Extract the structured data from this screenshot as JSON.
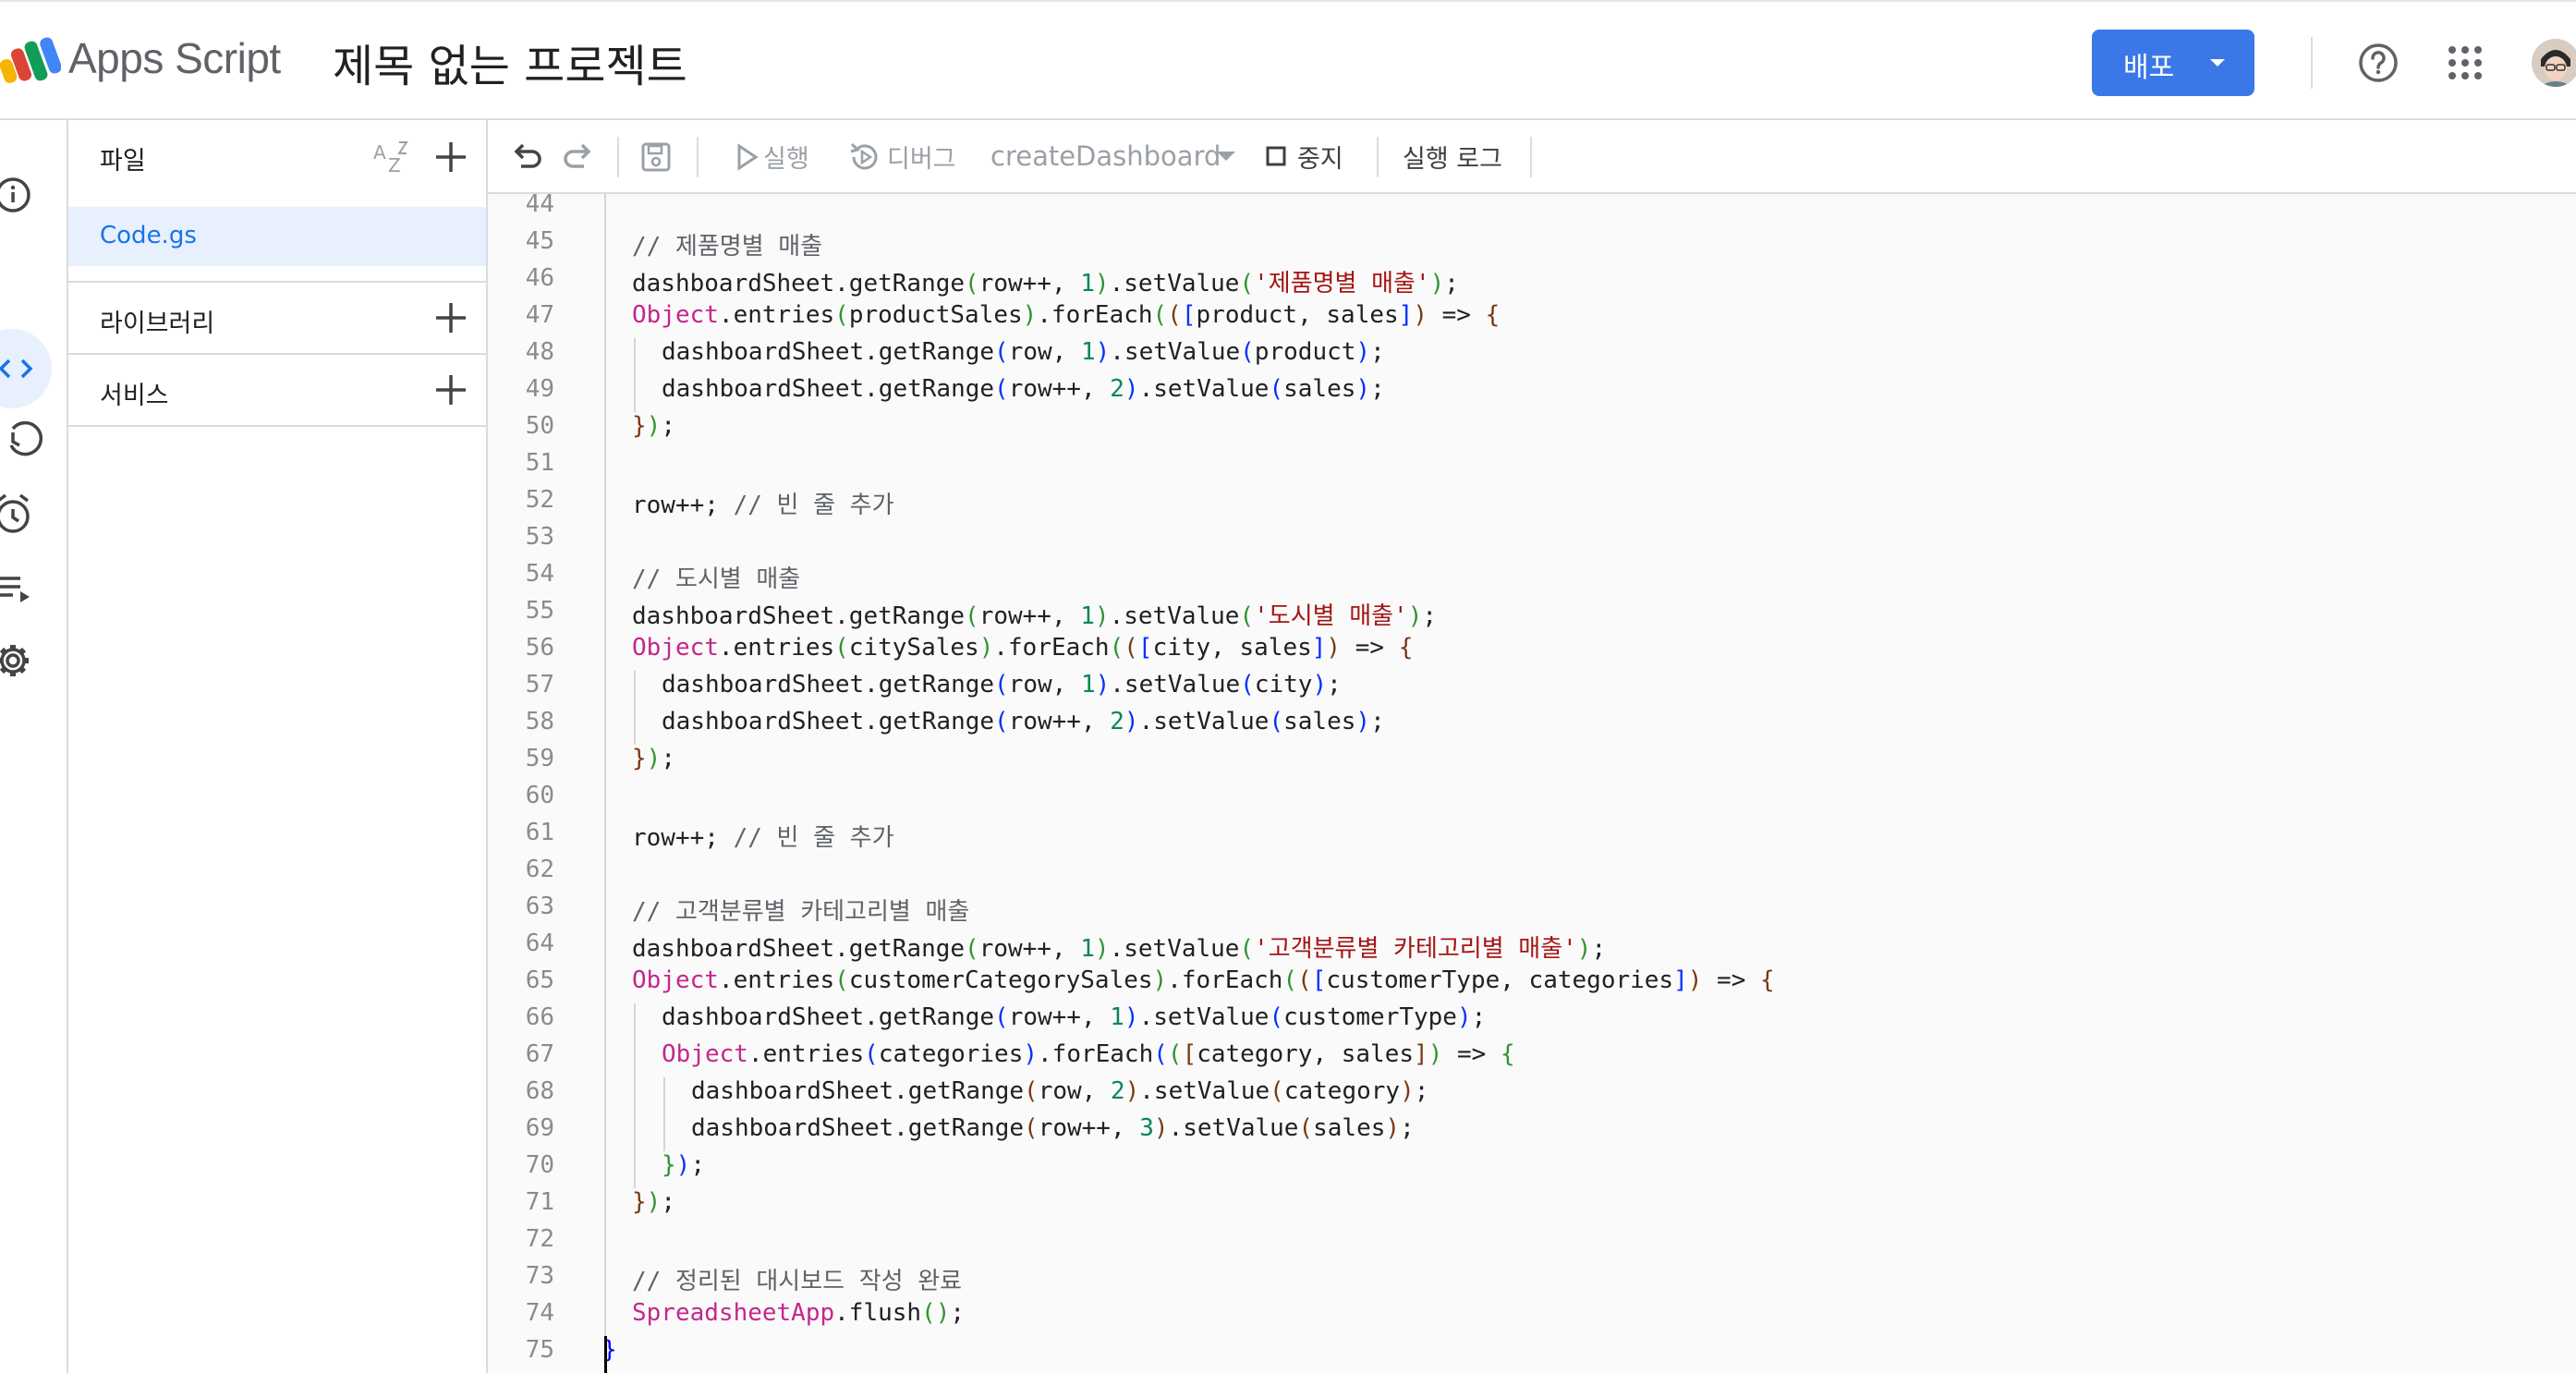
{
  "header": {
    "app_name": "Apps Script",
    "project_title": "제목 없는 프로젝트",
    "deploy_label": "배포"
  },
  "files_panel": {
    "title": "파일",
    "files": [
      "Code.gs"
    ],
    "sections": [
      "라이브러리",
      "서비스"
    ]
  },
  "toolbar": {
    "run_label": "실행",
    "debug_label": "디버그",
    "function_name": "createDashboard",
    "stop_label": "중지",
    "exec_log_label": "실행 로그"
  },
  "colors": {
    "accent": "#3b78e7",
    "keyword": "#c4278c",
    "string": "#a31515",
    "number": "#098658",
    "comment": "#5f6368"
  },
  "editor": {
    "lines": [
      {
        "n": "44",
        "indent": 0,
        "tokens": []
      },
      {
        "n": "45",
        "indent": 0,
        "tokens": [
          {
            "t": "// 제품명별 매출",
            "c": "cmt"
          }
        ]
      },
      {
        "n": "46",
        "indent": 0,
        "tokens": [
          {
            "t": "dashboardSheet.getRange"
          },
          {
            "t": "(",
            "c": "p1"
          },
          {
            "t": "row++, "
          },
          {
            "t": "1",
            "c": "num"
          },
          {
            "t": ")",
            "c": "p1"
          },
          {
            "t": ".setValue"
          },
          {
            "t": "(",
            "c": "p1"
          },
          {
            "t": "'제품명별 매출'",
            "c": "str"
          },
          {
            "t": ")",
            "c": "p1"
          },
          {
            "t": ";"
          }
        ]
      },
      {
        "n": "47",
        "indent": 0,
        "tokens": [
          {
            "t": "Object",
            "c": "kw"
          },
          {
            "t": ".entries"
          },
          {
            "t": "(",
            "c": "p1"
          },
          {
            "t": "productSales"
          },
          {
            "t": ")",
            "c": "p1"
          },
          {
            "t": ".forEach"
          },
          {
            "t": "(",
            "c": "p1"
          },
          {
            "t": "(",
            "c": "p2"
          },
          {
            "t": "[",
            "c": "p3"
          },
          {
            "t": "product, sales"
          },
          {
            "t": "]",
            "c": "p3"
          },
          {
            "t": ")",
            "c": "p2"
          },
          {
            "t": " => "
          },
          {
            "t": "{",
            "c": "p2"
          }
        ]
      },
      {
        "n": "48",
        "indent": 1,
        "tokens": [
          {
            "t": "dashboardSheet.getRange"
          },
          {
            "t": "(",
            "c": "p3"
          },
          {
            "t": "row, "
          },
          {
            "t": "1",
            "c": "num"
          },
          {
            "t": ")",
            "c": "p3"
          },
          {
            "t": ".setValue"
          },
          {
            "t": "(",
            "c": "p3"
          },
          {
            "t": "product"
          },
          {
            "t": ")",
            "c": "p3"
          },
          {
            "t": ";"
          }
        ]
      },
      {
        "n": "49",
        "indent": 1,
        "tokens": [
          {
            "t": "dashboardSheet.getRange"
          },
          {
            "t": "(",
            "c": "p3"
          },
          {
            "t": "row++, "
          },
          {
            "t": "2",
            "c": "num"
          },
          {
            "t": ")",
            "c": "p3"
          },
          {
            "t": ".setValue"
          },
          {
            "t": "(",
            "c": "p3"
          },
          {
            "t": "sales"
          },
          {
            "t": ")",
            "c": "p3"
          },
          {
            "t": ";"
          }
        ]
      },
      {
        "n": "50",
        "indent": 0,
        "tokens": [
          {
            "t": "}",
            "c": "p2"
          },
          {
            "t": ")",
            "c": "p1"
          },
          {
            "t": ";"
          }
        ]
      },
      {
        "n": "51",
        "indent": 0,
        "tokens": []
      },
      {
        "n": "52",
        "indent": 0,
        "tokens": [
          {
            "t": "row++; "
          },
          {
            "t": "// 빈 줄 추가",
            "c": "cmt"
          }
        ]
      },
      {
        "n": "53",
        "indent": 0,
        "tokens": []
      },
      {
        "n": "54",
        "indent": 0,
        "tokens": [
          {
            "t": "// 도시별 매출",
            "c": "cmt"
          }
        ]
      },
      {
        "n": "55",
        "indent": 0,
        "tokens": [
          {
            "t": "dashboardSheet.getRange"
          },
          {
            "t": "(",
            "c": "p1"
          },
          {
            "t": "row++, "
          },
          {
            "t": "1",
            "c": "num"
          },
          {
            "t": ")",
            "c": "p1"
          },
          {
            "t": ".setValue"
          },
          {
            "t": "(",
            "c": "p1"
          },
          {
            "t": "'도시별 매출'",
            "c": "str"
          },
          {
            "t": ")",
            "c": "p1"
          },
          {
            "t": ";"
          }
        ]
      },
      {
        "n": "56",
        "indent": 0,
        "tokens": [
          {
            "t": "Object",
            "c": "kw"
          },
          {
            "t": ".entries"
          },
          {
            "t": "(",
            "c": "p1"
          },
          {
            "t": "citySales"
          },
          {
            "t": ")",
            "c": "p1"
          },
          {
            "t": ".forEach"
          },
          {
            "t": "(",
            "c": "p1"
          },
          {
            "t": "(",
            "c": "p2"
          },
          {
            "t": "[",
            "c": "p3"
          },
          {
            "t": "city, sales"
          },
          {
            "t": "]",
            "c": "p3"
          },
          {
            "t": ")",
            "c": "p2"
          },
          {
            "t": " => "
          },
          {
            "t": "{",
            "c": "p2"
          }
        ]
      },
      {
        "n": "57",
        "indent": 1,
        "tokens": [
          {
            "t": "dashboardSheet.getRange"
          },
          {
            "t": "(",
            "c": "p3"
          },
          {
            "t": "row, "
          },
          {
            "t": "1",
            "c": "num"
          },
          {
            "t": ")",
            "c": "p3"
          },
          {
            "t": ".setValue"
          },
          {
            "t": "(",
            "c": "p3"
          },
          {
            "t": "city"
          },
          {
            "t": ")",
            "c": "p3"
          },
          {
            "t": ";"
          }
        ]
      },
      {
        "n": "58",
        "indent": 1,
        "tokens": [
          {
            "t": "dashboardSheet.getRange"
          },
          {
            "t": "(",
            "c": "p3"
          },
          {
            "t": "row++, "
          },
          {
            "t": "2",
            "c": "num"
          },
          {
            "t": ")",
            "c": "p3"
          },
          {
            "t": ".setValue"
          },
          {
            "t": "(",
            "c": "p3"
          },
          {
            "t": "sales"
          },
          {
            "t": ")",
            "c": "p3"
          },
          {
            "t": ";"
          }
        ]
      },
      {
        "n": "59",
        "indent": 0,
        "tokens": [
          {
            "t": "}",
            "c": "p2"
          },
          {
            "t": ")",
            "c": "p1"
          },
          {
            "t": ";"
          }
        ]
      },
      {
        "n": "60",
        "indent": 0,
        "tokens": []
      },
      {
        "n": "61",
        "indent": 0,
        "tokens": [
          {
            "t": "row++; "
          },
          {
            "t": "// 빈 줄 추가",
            "c": "cmt"
          }
        ]
      },
      {
        "n": "62",
        "indent": 0,
        "tokens": []
      },
      {
        "n": "63",
        "indent": 0,
        "tokens": [
          {
            "t": "// 고객분류별 카테고리별 매출",
            "c": "cmt"
          }
        ]
      },
      {
        "n": "64",
        "indent": 0,
        "tokens": [
          {
            "t": "dashboardSheet.getRange"
          },
          {
            "t": "(",
            "c": "p1"
          },
          {
            "t": "row++, "
          },
          {
            "t": "1",
            "c": "num"
          },
          {
            "t": ")",
            "c": "p1"
          },
          {
            "t": ".setValue"
          },
          {
            "t": "(",
            "c": "p1"
          },
          {
            "t": "'고객분류별 카테고리별 매출'",
            "c": "str"
          },
          {
            "t": ")",
            "c": "p1"
          },
          {
            "t": ";"
          }
        ]
      },
      {
        "n": "65",
        "indent": 0,
        "tokens": [
          {
            "t": "Object",
            "c": "kw"
          },
          {
            "t": ".entries"
          },
          {
            "t": "(",
            "c": "p1"
          },
          {
            "t": "customerCategorySales"
          },
          {
            "t": ")",
            "c": "p1"
          },
          {
            "t": ".forEach"
          },
          {
            "t": "(",
            "c": "p1"
          },
          {
            "t": "(",
            "c": "p2"
          },
          {
            "t": "[",
            "c": "p3"
          },
          {
            "t": "customerType, categories"
          },
          {
            "t": "]",
            "c": "p3"
          },
          {
            "t": ")",
            "c": "p2"
          },
          {
            "t": " => "
          },
          {
            "t": "{",
            "c": "p2"
          }
        ]
      },
      {
        "n": "66",
        "indent": 1,
        "tokens": [
          {
            "t": "dashboardSheet.getRange"
          },
          {
            "t": "(",
            "c": "p3"
          },
          {
            "t": "row++, "
          },
          {
            "t": "1",
            "c": "num"
          },
          {
            "t": ")",
            "c": "p3"
          },
          {
            "t": ".setValue"
          },
          {
            "t": "(",
            "c": "p3"
          },
          {
            "t": "customerType"
          },
          {
            "t": ")",
            "c": "p3"
          },
          {
            "t": ";"
          }
        ]
      },
      {
        "n": "67",
        "indent": 1,
        "tokens": [
          {
            "t": "Object",
            "c": "kw"
          },
          {
            "t": ".entries"
          },
          {
            "t": "(",
            "c": "p3"
          },
          {
            "t": "categories"
          },
          {
            "t": ")",
            "c": "p3"
          },
          {
            "t": ".forEach"
          },
          {
            "t": "(",
            "c": "p3"
          },
          {
            "t": "(",
            "c": "p1"
          },
          {
            "t": "[",
            "c": "p2"
          },
          {
            "t": "category, sales"
          },
          {
            "t": "]",
            "c": "p2"
          },
          {
            "t": ")",
            "c": "p1"
          },
          {
            "t": " => "
          },
          {
            "t": "{",
            "c": "p1"
          }
        ]
      },
      {
        "n": "68",
        "indent": 2,
        "tokens": [
          {
            "t": "dashboardSheet.getRange"
          },
          {
            "t": "(",
            "c": "p2"
          },
          {
            "t": "row, "
          },
          {
            "t": "2",
            "c": "num"
          },
          {
            "t": ")",
            "c": "p2"
          },
          {
            "t": ".setValue"
          },
          {
            "t": "(",
            "c": "p2"
          },
          {
            "t": "category"
          },
          {
            "t": ")",
            "c": "p2"
          },
          {
            "t": ";"
          }
        ]
      },
      {
        "n": "69",
        "indent": 2,
        "tokens": [
          {
            "t": "dashboardSheet.getRange"
          },
          {
            "t": "(",
            "c": "p2"
          },
          {
            "t": "row++, "
          },
          {
            "t": "3",
            "c": "num"
          },
          {
            "t": ")",
            "c": "p2"
          },
          {
            "t": ".setValue"
          },
          {
            "t": "(",
            "c": "p2"
          },
          {
            "t": "sales"
          },
          {
            "t": ")",
            "c": "p2"
          },
          {
            "t": ";"
          }
        ]
      },
      {
        "n": "70",
        "indent": 1,
        "tokens": [
          {
            "t": "}",
            "c": "p1"
          },
          {
            "t": ")",
            "c": "p3"
          },
          {
            "t": ";"
          }
        ]
      },
      {
        "n": "71",
        "indent": 0,
        "tokens": [
          {
            "t": "}",
            "c": "p2"
          },
          {
            "t": ")",
            "c": "p1"
          },
          {
            "t": ";"
          }
        ]
      },
      {
        "n": "72",
        "indent": 0,
        "tokens": []
      },
      {
        "n": "73",
        "indent": 0,
        "tokens": [
          {
            "t": "// 정리된 대시보드 작성 완료",
            "c": "cmt"
          }
        ]
      },
      {
        "n": "74",
        "indent": 0,
        "tokens": [
          {
            "t": "SpreadsheetApp",
            "c": "kw"
          },
          {
            "t": ".flush"
          },
          {
            "t": "(",
            "c": "p1"
          },
          {
            "t": ")",
            "c": "p1"
          },
          {
            "t": ";"
          }
        ]
      },
      {
        "n": "75",
        "indent": -1,
        "tokens": [
          {
            "t": "}",
            "c": "p0"
          }
        ]
      }
    ]
  }
}
